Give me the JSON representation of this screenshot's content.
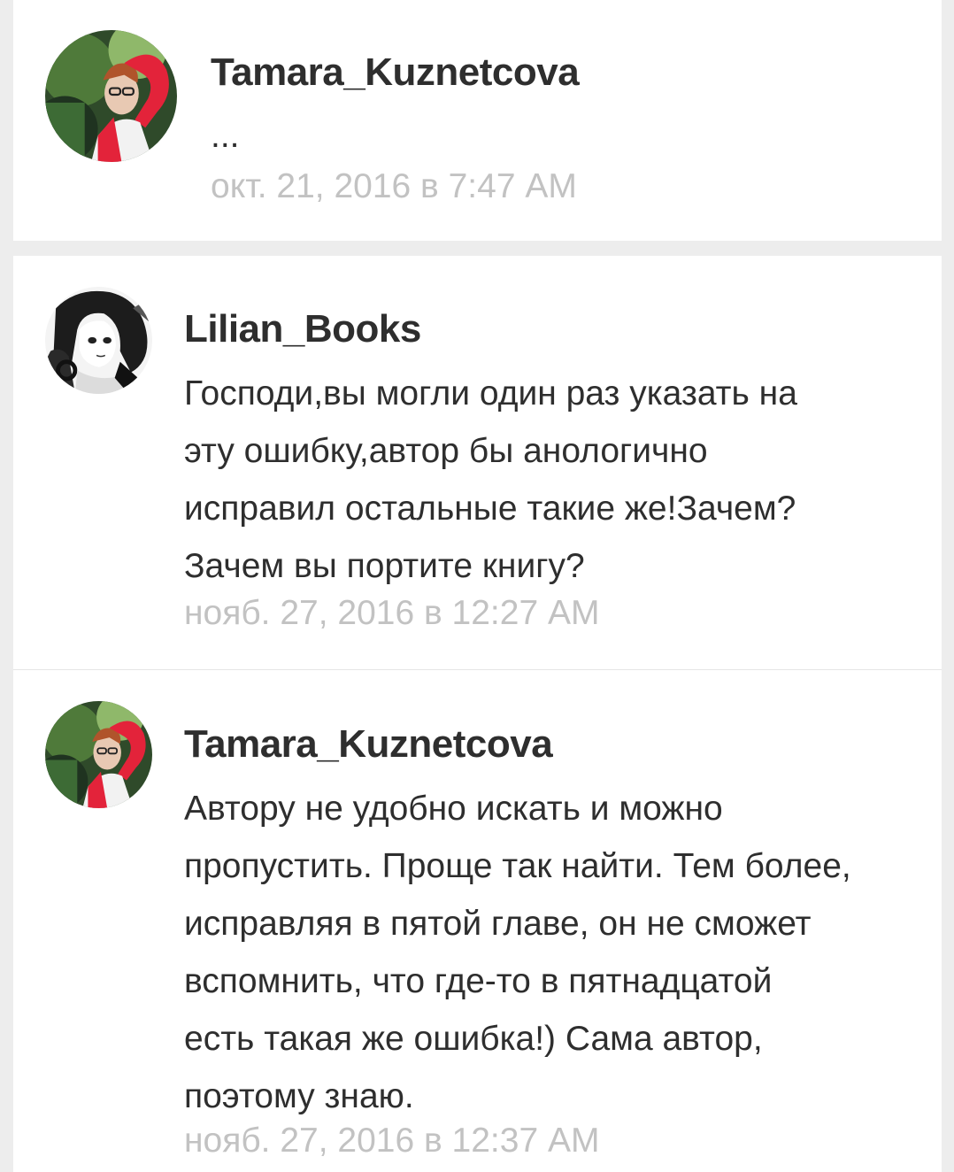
{
  "comments": [
    {
      "author": "Tamara_Kuznetcova",
      "avatar_icon": "user-photo-red-sleeve-icon",
      "text": "...",
      "timestamp": "окт. 21, 2016 в 7:47 AM"
    },
    {
      "author": "Lilian_Books",
      "avatar_icon": "user-photo-manga-girl-icon",
      "text_lines": [
        "Господи,вы могли один раз указать на",
        "эту ошибку,автор бы анологично",
        "исправил остальные такие же!Зачем?",
        "Зачем вы портите книгу?"
      ],
      "timestamp": "нояб. 27, 2016 в 12:27 AM"
    },
    {
      "author": "Tamara_Kuznetcova",
      "avatar_icon": "user-photo-red-sleeve-icon",
      "text_lines": [
        "Автору не удобно искать и можно",
        "пропустить. Проще так найти. Тем более,",
        "исправляя в пятой главе, он не сможет",
        "вспомнить, что где-то в пятнадцатой",
        "есть такая же ошибка!) Сама автор,",
        "поэтому знаю."
      ],
      "timestamp": "нояб. 27, 2016 в 12:37 AM"
    }
  ],
  "colors": {
    "background": "#ededed",
    "card": "#ffffff",
    "name": "#2e2e2e",
    "text": "#2e2e2e",
    "timestamp": "#c2c2c2"
  }
}
